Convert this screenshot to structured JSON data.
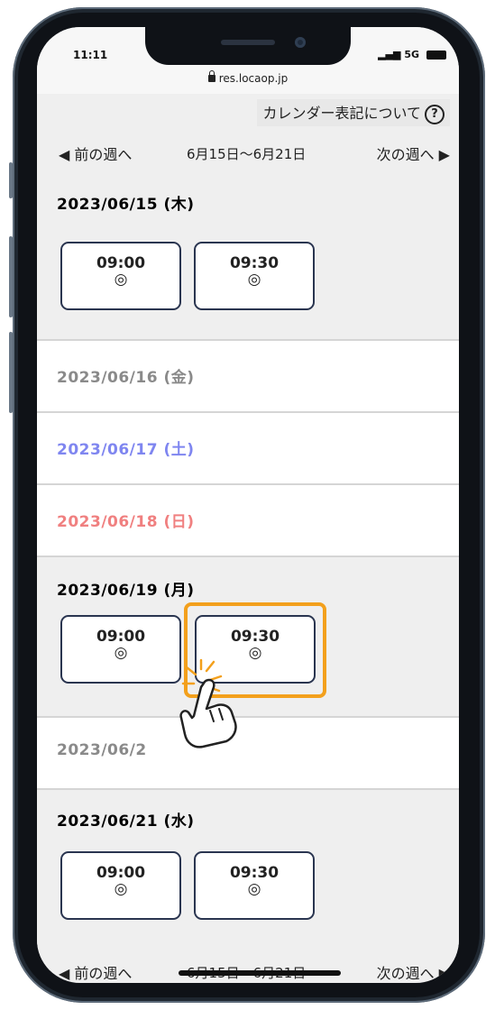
{
  "status_bar": {
    "time": "11:11",
    "network": "5G"
  },
  "browser": {
    "url": "res.locaop.jp"
  },
  "calendar_note": {
    "label": "カレンダー表記について",
    "help": "?"
  },
  "week_nav": {
    "prev": "◀ 前の週へ",
    "range": "6月15日〜6月21日",
    "next": "次の週へ ▶"
  },
  "days": [
    {
      "date": "2023/06/15 (木)",
      "color": "#222222",
      "slots": [
        {
          "time": "09:00",
          "mark": "◎"
        },
        {
          "time": "09:30",
          "mark": "◎"
        }
      ]
    },
    {
      "date": "2023/06/16 (金)",
      "color": "#8a8a8a",
      "slots": []
    },
    {
      "date": "2023/06/17 (土)",
      "color": "#7f86f0",
      "slots": []
    },
    {
      "date": "2023/06/18 (日)",
      "color": "#f08080",
      "slots": []
    },
    {
      "date": "2023/06/19 (月)",
      "color": "#222222",
      "slots": [
        {
          "time": "09:00",
          "mark": "◎"
        },
        {
          "time": "09:30",
          "mark": "◎"
        }
      ]
    },
    {
      "date": "2023/06/2",
      "color": "#8a8a8a",
      "slots": []
    },
    {
      "date": "2023/06/21 (水)",
      "color": "#222222",
      "slots": [
        {
          "time": "09:00",
          "mark": "◎"
        },
        {
          "time": "09:30",
          "mark": "◎"
        }
      ]
    }
  ],
  "bottom_nav": {
    "prev": "◀ 前の週へ",
    "range": "6月15日〜6月21日",
    "next": "次の週へ ▶"
  },
  "accent": {
    "highlight": "#f3a01c",
    "slot_border": "#2a3550"
  },
  "icons": {
    "tap": "tap-hand-icon",
    "help": "question-circle-icon",
    "lock": "lock-icon"
  }
}
